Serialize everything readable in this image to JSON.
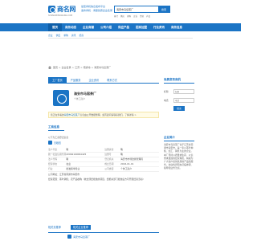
{
  "header": {
    "logo_text": "商名网",
    "logo_sub": "SHANGMINGWANG.COM",
    "slogan_1": "最佳商机信息发布平台",
    "slogan_2": "发布商机 · 海量优质企业名录",
    "search_value": "海安市马窑茶厂",
    "search_button": "搜索",
    "hot_links": [
      "热门",
      "供应",
      "求购",
      "企业",
      "资讯",
      "产品"
    ]
  },
  "nav": {
    "items": [
      "首页",
      "商务动态",
      "企业商铺",
      "公司介绍",
      "供应产品",
      "招商加盟",
      "行业资讯",
      "商务信息"
    ]
  },
  "subnav": {
    "items": [
      "企业",
      "供应",
      "求购",
      "资讯",
      "招商"
    ]
  },
  "breadcrumb": {
    "items": [
      "首页",
      "企业名录",
      "江苏",
      "南通市",
      "海安市马窑茶厂"
    ],
    "separator": " > "
  },
  "main": {
    "tabs": [
      "工厂首页",
      "产品服务",
      "企业资讯",
      "联系方式"
    ],
    "company_name": "海安市马窑茶厂",
    "company_type": "个体工商户",
    "notice_text": "您正在查看的",
    "notice_highlight": "海安市马窑茶厂",
    "notice_rest": "信息由公开数据整理，如有疑问请联系我们。了解详情 >",
    "section_title": "工商信息",
    "info_head": "以下为工商登记信息",
    "info_logo_text": "天眼查",
    "info_rows": [
      {
        "k1": "法人代表",
        "v1": "略",
        "k2": "注册资金",
        "v2": "略"
      },
      {
        "k1": "统一社会信用代码",
        "v1": "32062160094425",
        "k2": "注册号",
        "v2": "略"
      },
      {
        "k1": "法人代码",
        "v1": "略",
        "k2": "登记机关",
        "v2": "海安市市场监督管理局"
      },
      {
        "k1": "经营状态",
        "v1": "在业",
        "k2": "成立日期",
        "v2": "2016-01-01"
      },
      {
        "k1": "行业",
        "v1": "批发和零售业",
        "k2": "公司类型",
        "v2": "个体工商户"
      }
    ],
    "address": "公司地址：江苏省南通市海安市",
    "scope": "经营范围：茶叶销售；农产品收购（依法须经批准的项目，经相关部门批准后方可开展经营活动）"
  },
  "more": {
    "items": [
      "相关页推荐",
      "相关企业推荐"
    ],
    "card_label": "海安市马窑茶厂"
  },
  "sidebar": {
    "title": "免费发布商机",
    "fields": [
      {
        "label": "标题",
        "placeholder": "标题"
      },
      {
        "label": "电话",
        "placeholder": "电话"
      }
    ],
    "submit": "提交",
    "title2": "企业简介",
    "intro": "海安市马窑茶厂位于江苏省南通市海安市，是一家以茶叶种植、加工、销售为主的企业。本厂坚持以质量求生存、以信誉求发展的经营理念，竭诚为广大客户提供优质的产品和服务。欢迎各界朋友莅临参观、指导和业务洽谈。"
  }
}
